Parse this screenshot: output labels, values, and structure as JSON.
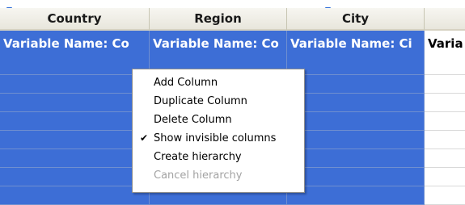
{
  "columns": [
    {
      "header": "Country",
      "variable_label": "Variable Name: Co"
    },
    {
      "header": "Region",
      "variable_label": "Variable Name: Co"
    },
    {
      "header": "City",
      "variable_label": "Variable Name: Ci"
    },
    {
      "header": "",
      "variable_label": "Varia"
    }
  ],
  "context_menu": {
    "items": [
      {
        "label": "Add Column",
        "checked": false,
        "enabled": true
      },
      {
        "label": "Duplicate Column",
        "checked": false,
        "enabled": true
      },
      {
        "label": "Delete Column",
        "checked": false,
        "enabled": true
      },
      {
        "label": "Show invisible columns",
        "checked": true,
        "enabled": true
      },
      {
        "label": "Create hierarchy",
        "checked": false,
        "enabled": true
      },
      {
        "label": "Cancel hierarchy",
        "checked": false,
        "enabled": false
      }
    ],
    "check_glyph": "✔"
  },
  "colors": {
    "selection": "#3d6ed6",
    "marker": "#2c6cd8"
  }
}
